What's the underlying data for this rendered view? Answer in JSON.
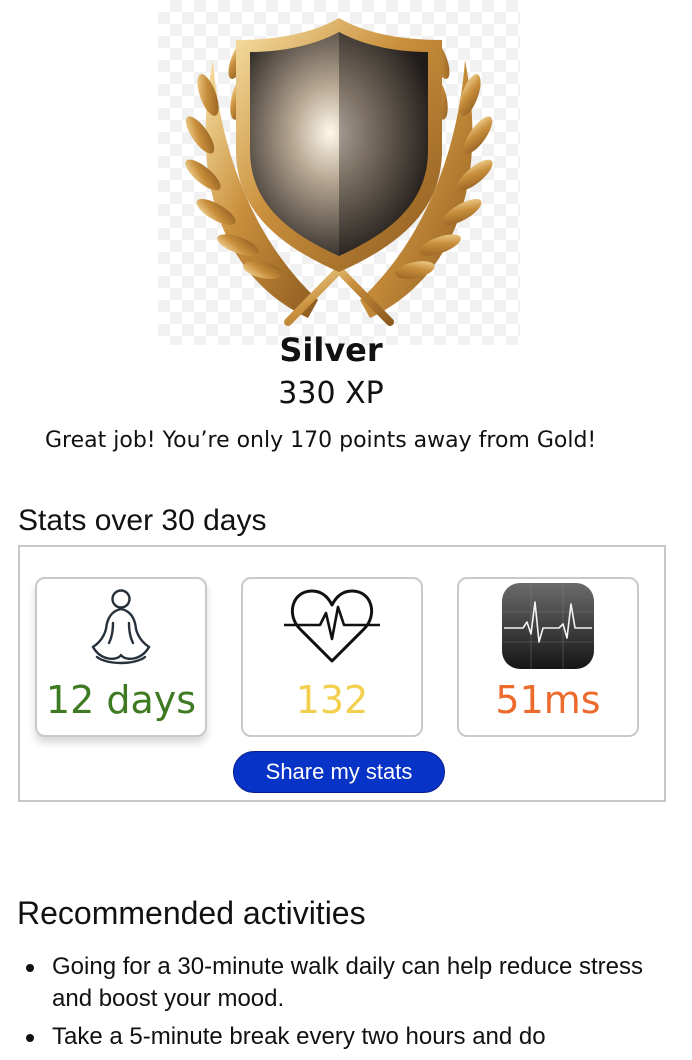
{
  "badge": {
    "image_name": "silver-shield-laurel-badge",
    "rank": "Silver",
    "xp": "330 XP",
    "message": "Great job! You’re only 170 points away from Gold!"
  },
  "stats": {
    "heading": "Stats over 30 days",
    "cards": [
      {
        "icon": "meditation-icon",
        "value": "12 days",
        "color": "#3e7a22"
      },
      {
        "icon": "heartbeat-icon",
        "value": "132",
        "color": "#f2cf4c"
      },
      {
        "icon": "ekg-monitor-icon",
        "value": "51ms",
        "color": "#ec6a2c"
      }
    ],
    "share_label": "Share my stats",
    "share_color": "#0733c7"
  },
  "recommended": {
    "heading": "Recommended activities",
    "items": [
      "Going for a 30-minute walk daily can help reduce stress and boost your mood.",
      "Take a 5-minute break every two hours and do"
    ]
  }
}
